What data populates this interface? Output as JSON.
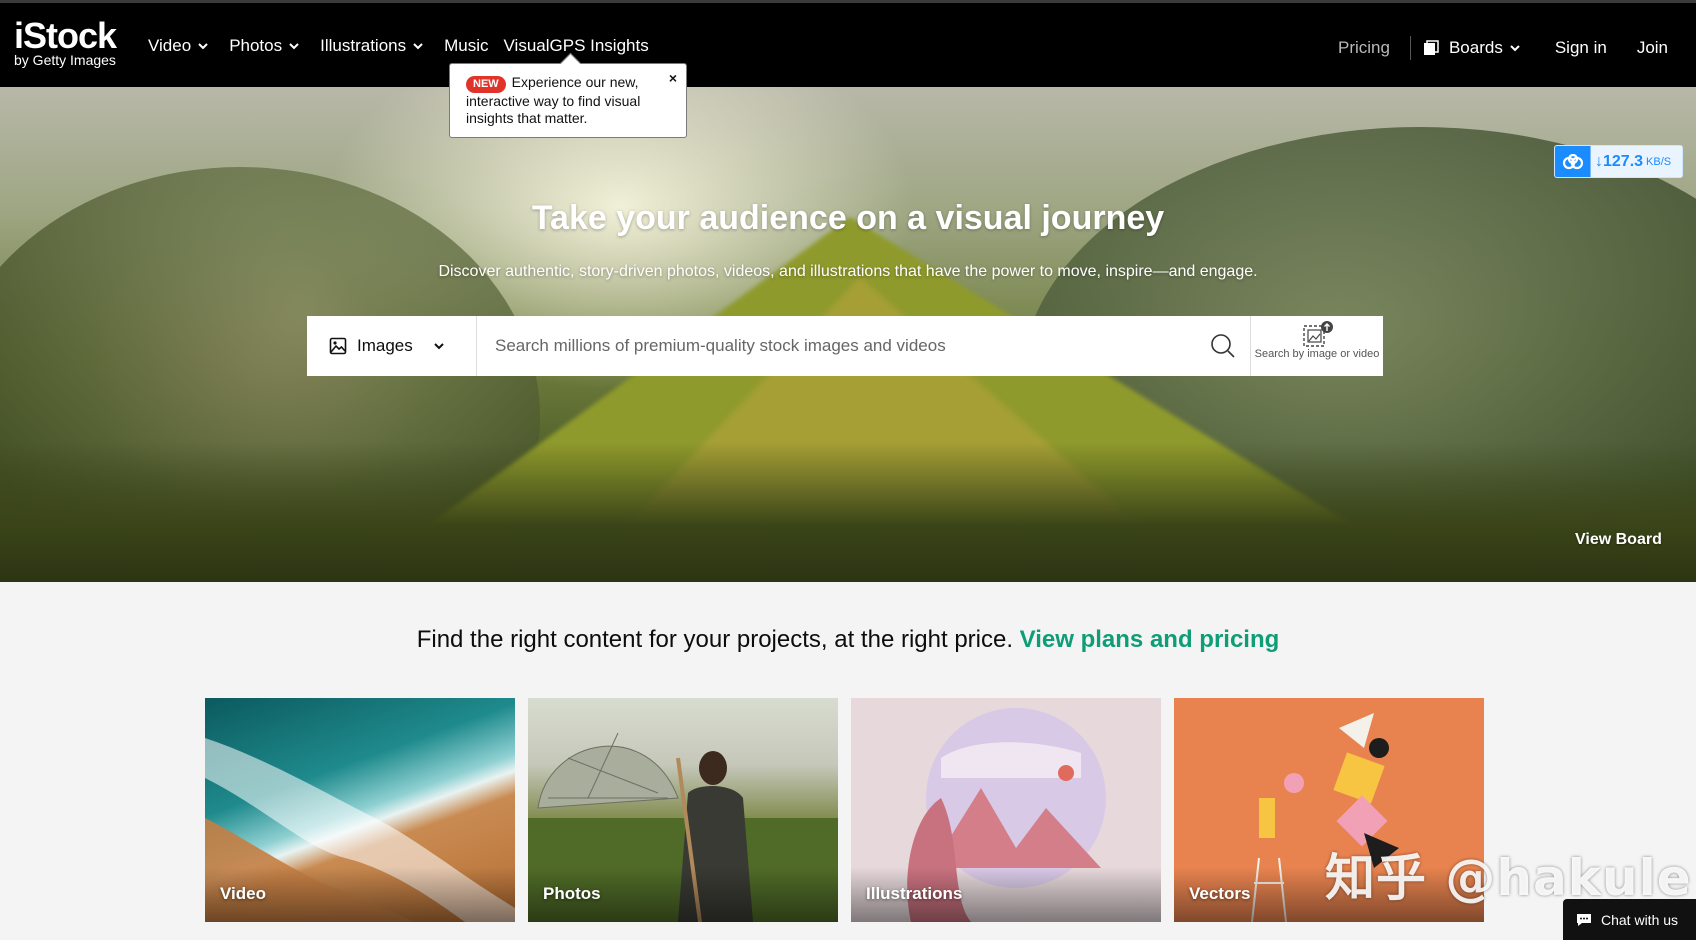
{
  "header": {
    "logo_main": "iStock",
    "logo_sub": "by Getty Images",
    "nav": [
      {
        "label": "Video",
        "dropdown": true
      },
      {
        "label": "Photos",
        "dropdown": true
      },
      {
        "label": "Illustrations",
        "dropdown": true
      },
      {
        "label": "Music",
        "dropdown": false
      },
      {
        "label": "VisualGPS Insights",
        "dropdown": false
      }
    ],
    "pricing": "Pricing",
    "boards": "Boards",
    "sign_in": "Sign in",
    "join": "Join"
  },
  "tooltip": {
    "badge": "NEW",
    "text": "Experience our new, interactive way to find visual insights that matter.",
    "close": "×"
  },
  "hero": {
    "title": "Take your audience on a visual journey",
    "subtitle": "Discover authentic, story-driven photos, videos, and illustrations that have the power to move, inspire—and engage.",
    "view_board": "View Board"
  },
  "search": {
    "type_label": "Images",
    "placeholder": "Search millions of premium-quality stock images and videos",
    "visual_search_label": "Search by image or video"
  },
  "speed_badge": {
    "value": "↓127.3",
    "unit": "KB/S"
  },
  "promo": {
    "text": "Find the right content for your projects, at the right price.",
    "link": "View plans and pricing"
  },
  "tiles": [
    {
      "label": "Video"
    },
    {
      "label": "Photos"
    },
    {
      "label": "Illustrations"
    },
    {
      "label": "Vectors"
    }
  ],
  "chat": "Chat with us",
  "watermark": "知乎 @hakule",
  "colors": {
    "header_bg": "#000000",
    "accent_green": "#0f9d77",
    "badge_red": "#e0342a",
    "speed_blue": "#1a8cff"
  }
}
